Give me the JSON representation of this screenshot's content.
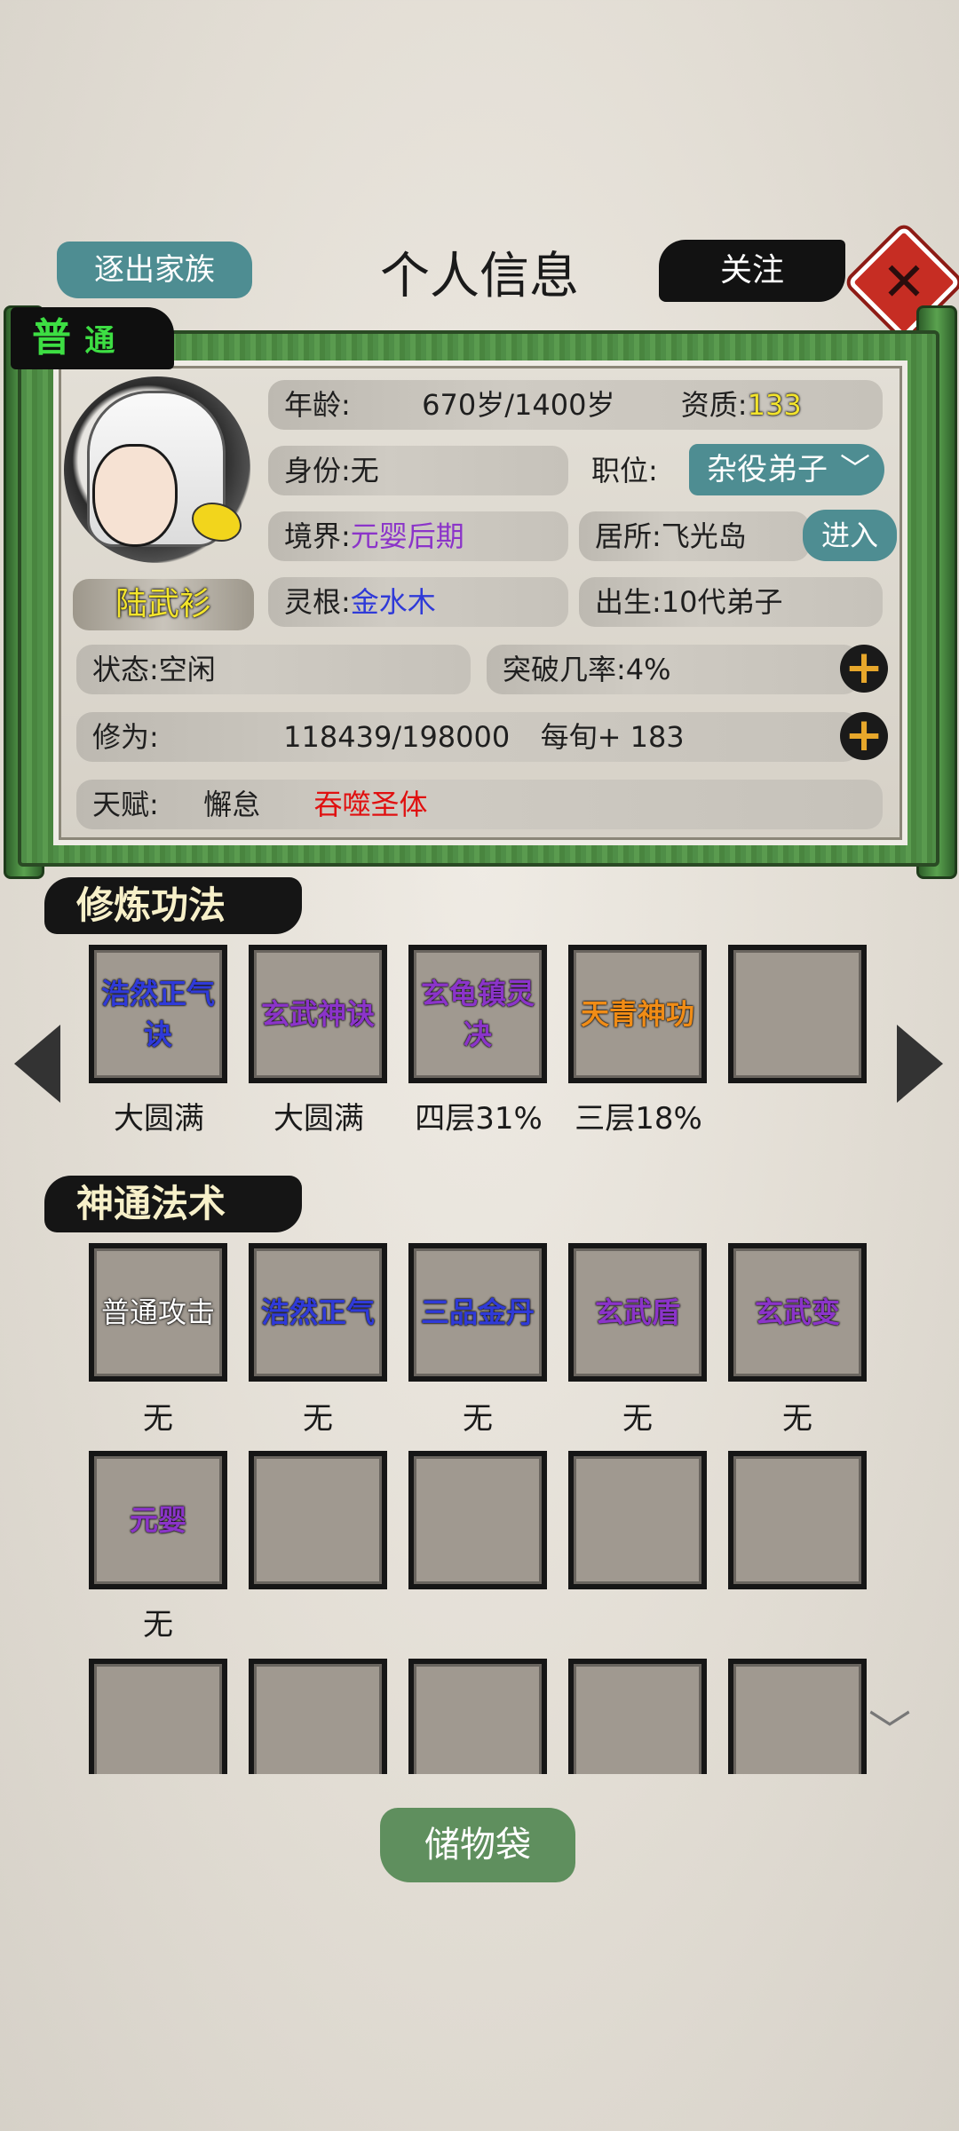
{
  "header": {
    "expel_label": "逐出家族",
    "title": "个人信息",
    "follow_label": "关注",
    "close_icon": "close-icon"
  },
  "profile": {
    "rank": "普",
    "rank_suffix": "通",
    "name": "陆武衫",
    "age_label": "年龄:",
    "age_value": "670岁/1400岁",
    "aptitude_label": "资质:",
    "aptitude_value": "133",
    "identity_label": "身份:",
    "identity_value": "无",
    "position_label": "职位:",
    "position_value": "杂役弟子",
    "realm_label": "境界:",
    "realm_value": "元婴后期",
    "residence_label": "居所:",
    "residence_value": "飞光岛",
    "enter_label": "进入",
    "root_label": "灵根:",
    "root_value": "金水木",
    "birth_label": "出生:",
    "birth_value": "10代弟子",
    "status_label": "状态:",
    "status_value": "空闲",
    "breakthrough_label": "突破几率:",
    "breakthrough_value": "4%",
    "cultivation_label": "修为:",
    "cultivation_value": "118439/198000",
    "per_turn_label": "每旬+",
    "per_turn_value": "183",
    "talent_label": "天赋:",
    "talent_1": "懈怠",
    "talent_2": "吞噬圣体"
  },
  "methods": {
    "title": "修炼功法",
    "items": [
      {
        "name": "浩然正气诀",
        "line1": "浩然正气",
        "line2": "诀",
        "progress": "大圆满",
        "color": "blue"
      },
      {
        "name": "玄武神诀",
        "line1": "玄武神诀",
        "line2": "",
        "progress": "大圆满",
        "color": "purple"
      },
      {
        "name": "玄龟镇灵决",
        "line1": "玄龟镇灵",
        "line2": "决",
        "progress": "四层31%",
        "color": "purple"
      },
      {
        "name": "天青神功",
        "line1": "天青神功",
        "line2": "",
        "progress": "三层18%",
        "color": "orange"
      },
      {
        "name": "",
        "line1": "",
        "line2": "",
        "progress": "",
        "color": ""
      }
    ]
  },
  "skills": {
    "title": "神通法术",
    "items": [
      {
        "name": "普通攻击",
        "level": "无",
        "color": "white"
      },
      {
        "name": "浩然正气",
        "level": "无",
        "color": "blue"
      },
      {
        "name": "三品金丹",
        "level": "无",
        "color": "blue"
      },
      {
        "name": "玄武盾",
        "level": "无",
        "color": "purple"
      },
      {
        "name": "玄武变",
        "level": "无",
        "color": "purple"
      },
      {
        "name": "元婴",
        "level": "无",
        "color": "purple"
      }
    ]
  },
  "footer": {
    "bag_label": "储物袋"
  }
}
